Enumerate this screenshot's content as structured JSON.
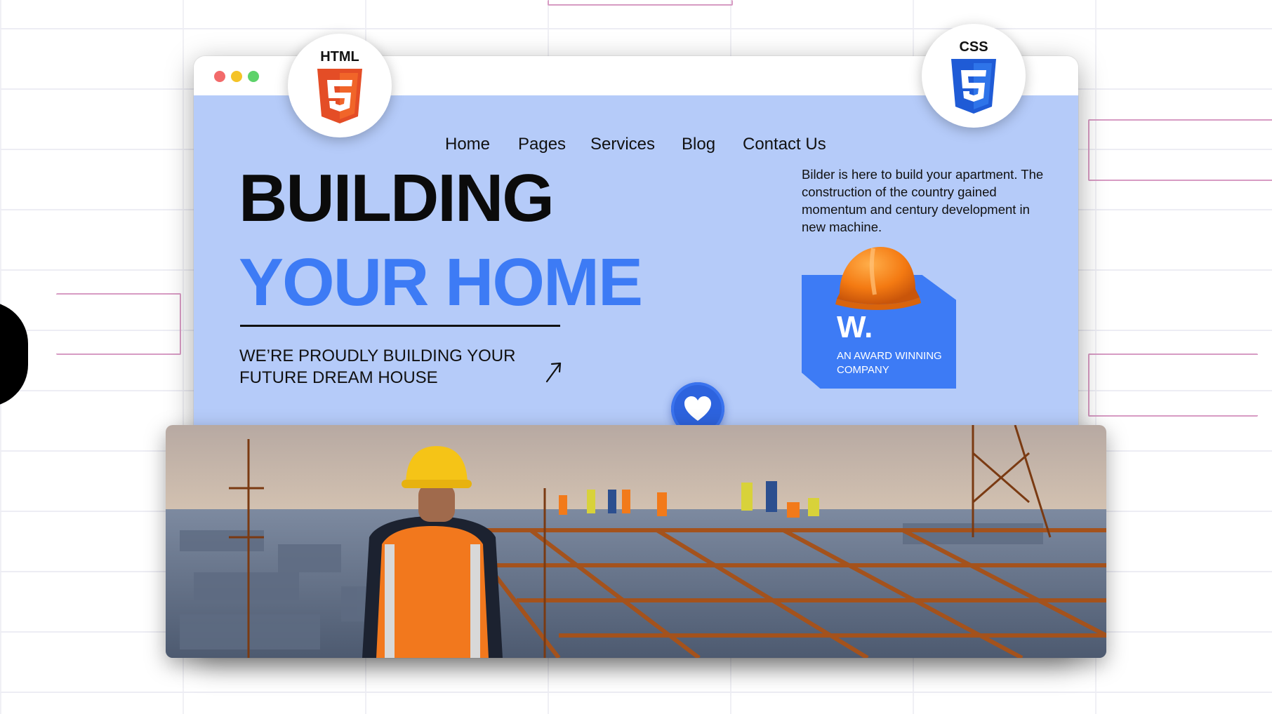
{
  "nav": {
    "items": [
      "Home",
      "Pages",
      "Services",
      "Blog",
      "Contact Us"
    ]
  },
  "hero": {
    "headline_line1": "BUILDING",
    "headline_line2": "YOUR HOME",
    "tagline": "WE’RE PROUDLY BUILDING YOUR FUTURE DREAM HOUSE",
    "intro": "Bilder is here to build your apartment. The construction of the country gained momentum and century development in new machine."
  },
  "award": {
    "mark": "W.",
    "text": "AN AWARD WINNING COMPANY"
  },
  "badges": {
    "html_label": "HTML",
    "css_label": "CSS"
  },
  "colors": {
    "hero_bg": "#b5cbf9",
    "accent_blue": "#3d7bf5",
    "html_orange": "#e44d26",
    "css_blue": "#1f5bd6"
  },
  "icons": [
    "html5-icon",
    "css3-icon",
    "hard-hat-icon",
    "heart-icon",
    "arrow-up-right-icon"
  ]
}
